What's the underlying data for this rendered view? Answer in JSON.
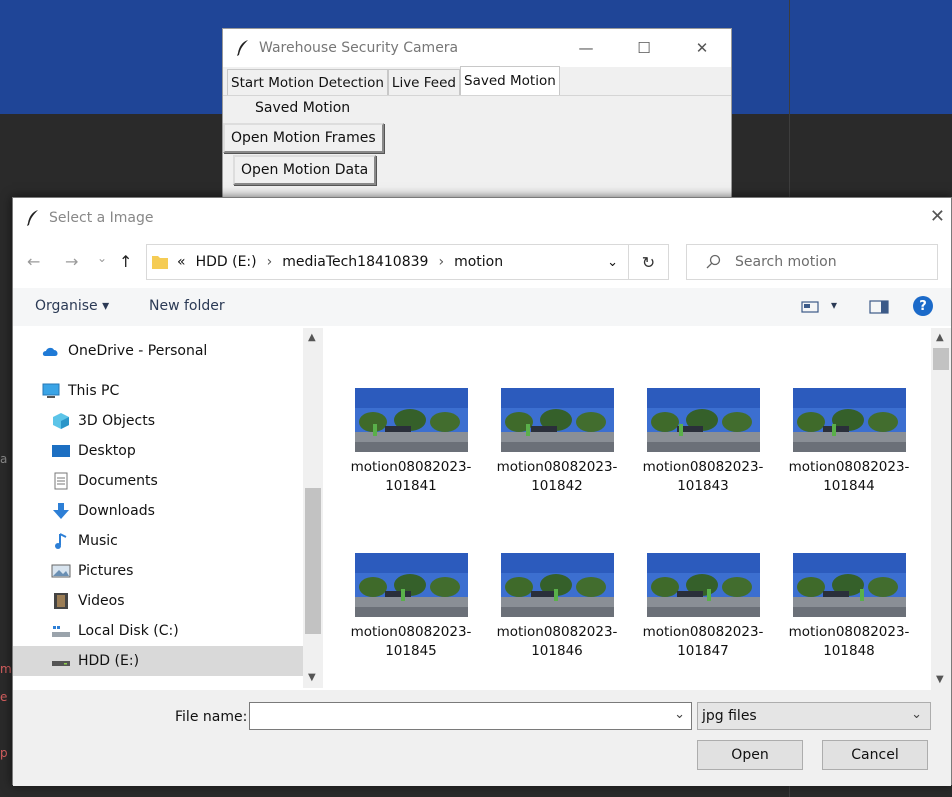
{
  "background": {
    "fragments": [
      "a",
      "m",
      "e",
      "p"
    ]
  },
  "tk_window": {
    "title": "Warehouse Security Camera",
    "controls": {
      "minimize": "—",
      "maximize": "☐",
      "close": "✕"
    },
    "tabs": [
      {
        "label": "Start Motion Detection"
      },
      {
        "label": "Live Feed"
      },
      {
        "label": "Saved Motion"
      }
    ],
    "section_label": "Saved Motion",
    "buttons": {
      "open_frames": "Open Motion Frames",
      "open_data": "Open Motion Data"
    }
  },
  "dialog": {
    "title": "Select a Image",
    "close": "✕",
    "nav": {
      "back": "←",
      "forward": "→",
      "recent": "⌄",
      "up": "↑"
    },
    "address": {
      "overflow": "«",
      "sep": "›",
      "crumbs": [
        "HDD (E:)",
        "mediaTech18410839",
        "motion"
      ],
      "dropdown": "⌄"
    },
    "refresh": "↻",
    "search_placeholder": "Search motion",
    "toolbar": {
      "organise": "Organise ▾",
      "new_folder": "New folder",
      "view_dropdown": "▾",
      "help": "?"
    },
    "nav_pane": [
      {
        "label": "OneDrive - Personal",
        "icon": "onedrive-icon"
      },
      {
        "label": "This PC",
        "icon": "this-pc-icon"
      },
      {
        "label": "3D Objects",
        "icon": "3d-objects-icon"
      },
      {
        "label": "Desktop",
        "icon": "desktop-icon"
      },
      {
        "label": "Documents",
        "icon": "documents-icon"
      },
      {
        "label": "Downloads",
        "icon": "downloads-icon"
      },
      {
        "label": "Music",
        "icon": "music-icon"
      },
      {
        "label": "Pictures",
        "icon": "pictures-icon"
      },
      {
        "label": "Videos",
        "icon": "videos-icon"
      },
      {
        "label": "Local Disk (C:)",
        "icon": "local-disk-icon"
      },
      {
        "label": "HDD (E:)",
        "icon": "hdd-icon"
      }
    ],
    "files": [
      {
        "name1": "motion08082023-",
        "name2": "101841"
      },
      {
        "name1": "motion08082023-",
        "name2": "101842"
      },
      {
        "name1": "motion08082023-",
        "name2": "101843"
      },
      {
        "name1": "motion08082023-",
        "name2": "101844"
      },
      {
        "name1": "motion08082023-",
        "name2": "101845"
      },
      {
        "name1": "motion08082023-",
        "name2": "101846"
      },
      {
        "name1": "motion08082023-",
        "name2": "101847"
      },
      {
        "name1": "motion08082023-",
        "name2": "101848"
      }
    ],
    "file_name_label": "File name:",
    "file_name_value": "",
    "file_type": "jpg files",
    "open_button": "Open",
    "cancel_button": "Cancel"
  }
}
